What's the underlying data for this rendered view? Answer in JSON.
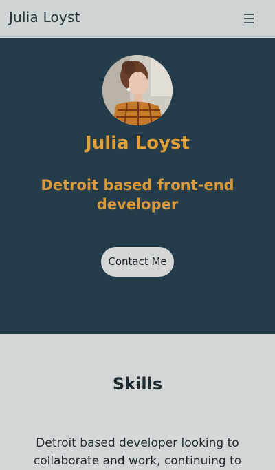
{
  "navbar": {
    "brand": "Julia Loyst",
    "menu_icon": "hamburger-menu-icon"
  },
  "hero": {
    "avatar_alt": "profile photo",
    "name": "Julia Loyst",
    "tagline": "Detroit based front-end developer",
    "contact_label": "Contact Me",
    "colors": {
      "background": "#253d4a",
      "accent": "#e0a03a"
    }
  },
  "skills": {
    "title": "Skills",
    "text": "Detroit based developer looking to collaborate and work, continuing to"
  }
}
